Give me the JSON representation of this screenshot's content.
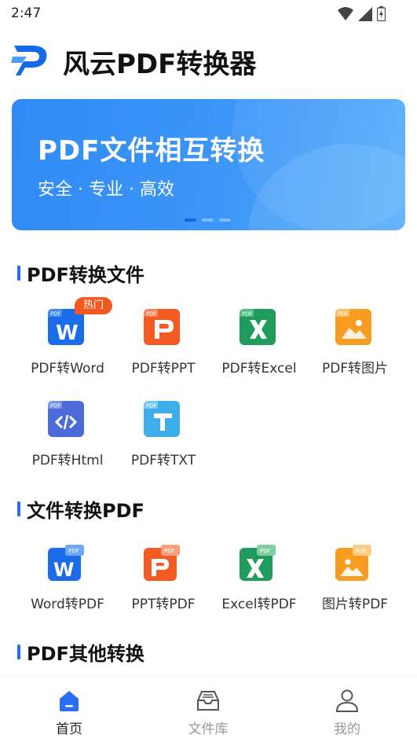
{
  "status_bar": {
    "time": "2:47",
    "icons": [
      "wifi-icon",
      "signal-icon",
      "battery-icon"
    ]
  },
  "header": {
    "title": "风云PDF转换器",
    "logo": "app-logo-icon"
  },
  "banner": {
    "title": "PDF文件相互转换",
    "subtitle": "安全 · 专业 · 高效",
    "dots": 3,
    "active_dot": 0
  },
  "sections": [
    {
      "title": "PDF转换文件",
      "items": [
        {
          "label": "PDF转Word",
          "icon": "word-icon",
          "color": "#1a6ce8",
          "badge": "热门"
        },
        {
          "label": "PDF转PPT",
          "icon": "ppt-icon",
          "color": "#f35b22"
        },
        {
          "label": "PDF转Excel",
          "icon": "excel-icon",
          "color": "#1f9c5c"
        },
        {
          "label": "PDF转图片",
          "icon": "image-icon",
          "color": "#f99d22"
        },
        {
          "label": "PDF转Html",
          "icon": "html-icon",
          "color": "#4a6bd8"
        },
        {
          "label": "PDF转TXT",
          "icon": "txt-icon",
          "color": "#3daee9"
        }
      ]
    },
    {
      "title": "文件转换PDF",
      "items": [
        {
          "label": "Word转PDF",
          "icon": "word-to-pdf-icon",
          "color": "#1a6ce8"
        },
        {
          "label": "PPT转PDF",
          "icon": "ppt-to-pdf-icon",
          "color": "#f35b22"
        },
        {
          "label": "Excel转PDF",
          "icon": "excel-to-pdf-icon",
          "color": "#1f9c5c"
        },
        {
          "label": "图片转PDF",
          "icon": "image-to-pdf-icon",
          "color": "#f99d22"
        }
      ]
    },
    {
      "title": "PDF其他转换",
      "items": []
    }
  ],
  "icon_tag": "PDF",
  "bottom_nav": [
    {
      "label": "首页",
      "icon": "home-icon",
      "active": true
    },
    {
      "label": "文件库",
      "icon": "inbox-icon",
      "active": false
    },
    {
      "label": "我的",
      "icon": "profile-icon",
      "active": false
    }
  ],
  "colors": {
    "accent": "#2a6ef5",
    "banner": "#3d97f8",
    "hot_badge": "#f4571f"
  }
}
